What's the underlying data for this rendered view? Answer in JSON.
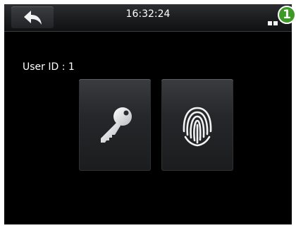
{
  "header": {
    "time": "16:32:24"
  },
  "badge": {
    "number": "1"
  },
  "user": {
    "label": "User ID : 1"
  },
  "options": [
    {
      "id": "password",
      "icon": "key-icon"
    },
    {
      "id": "fingerprint",
      "icon": "fingerprint-icon"
    }
  ],
  "colors": {
    "background": "#000000",
    "badge": "#3d9a27",
    "icon": "#f2f2f2"
  }
}
